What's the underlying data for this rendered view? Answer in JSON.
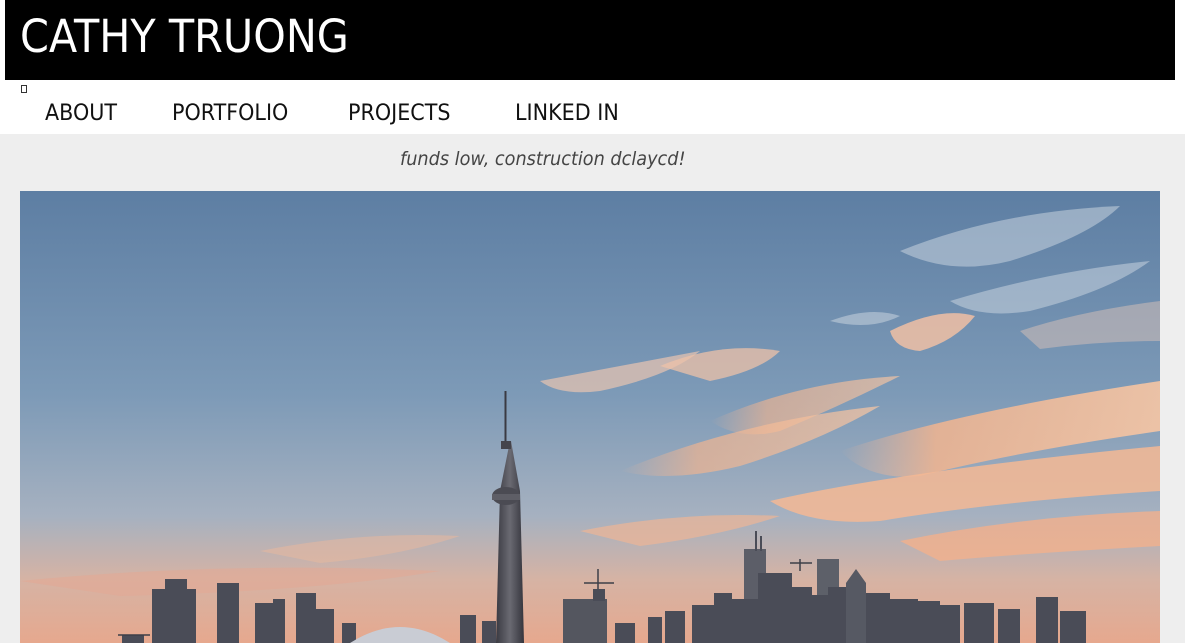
{
  "header": {
    "title": "CATHY TRUONG"
  },
  "nav": {
    "menu_icon": "menu-toggle-icon",
    "items": [
      {
        "label": "ABOUT"
      },
      {
        "label": "PORTFOLIO"
      },
      {
        "label": "PROJECTS"
      },
      {
        "label": "LINKED IN"
      }
    ]
  },
  "main": {
    "tagline": "funds low, construction dclaycd!",
    "hero_image": "toronto-skyline-sunset-photo"
  },
  "colors": {
    "header_bg": "#000000",
    "header_text": "#ffffff",
    "page_bg": "#eeeeee",
    "nav_text": "#111111"
  }
}
